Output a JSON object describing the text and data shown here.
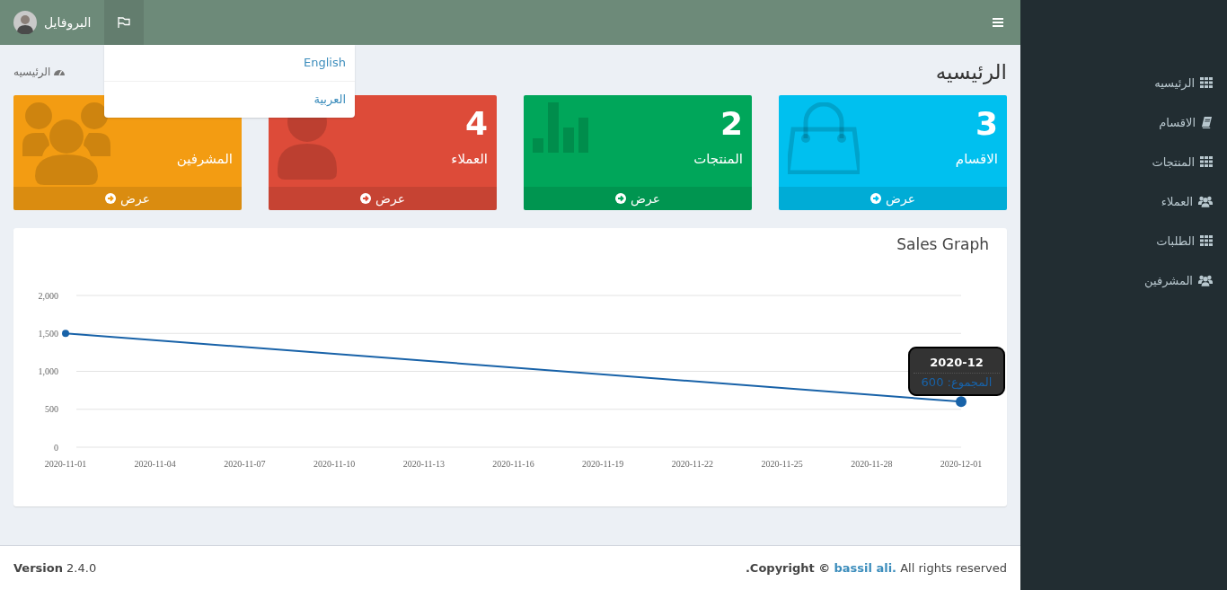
{
  "header": {
    "profile": {
      "label": "البروفايل"
    },
    "language_menu": {
      "expanded": true,
      "items": [
        {
          "label": "English"
        },
        {
          "label": "العربية"
        }
      ]
    }
  },
  "page": {
    "title": "الرئيسيه",
    "breadcrumb": "الرئيسيه"
  },
  "stats": [
    {
      "count": "3",
      "label": "الاقسام",
      "link": "عرض",
      "color": "#00c0ef"
    },
    {
      "count": "2",
      "label": "المنتجات",
      "link": "عرض",
      "color": "#00a65a"
    },
    {
      "count": "4",
      "label": "العملاء",
      "link": "عرض",
      "color": "#dd4b39"
    },
    {
      "label": "المشرفين",
      "link": "عرض",
      "color": "#f39c12"
    }
  ],
  "chart": {
    "title": "Sales Graph",
    "tooltip": {
      "title": "2020-12",
      "label": "المجموع: 600"
    },
    "chart_data": {
      "type": "line",
      "ylim": [
        0,
        2000
      ],
      "grid": true,
      "categories": [
        "2020-11-01",
        "2020-11-04",
        "2020-11-07",
        "2020-11-10",
        "2020-11-13",
        "2020-11-16",
        "2020-11-19",
        "2020-11-22",
        "2020-11-25",
        "2020-11-28",
        "2020-12-01"
      ],
      "series": [
        {
          "color": "#1862a8",
          "values": [
            1500,
            null,
            null,
            null,
            null,
            null,
            null,
            null,
            null,
            null,
            600
          ]
        }
      ],
      "yticks": [
        {
          "value": 0,
          "label": "0"
        },
        {
          "value": 500,
          "label": "500"
        },
        {
          "value": 1000,
          "label": "1,000"
        },
        {
          "value": 1500,
          "label": "1,500"
        },
        {
          "value": 2000,
          "label": "2,000"
        }
      ]
    }
  },
  "sidebar": {
    "items": [
      {
        "label": "الرئيسيه"
      },
      {
        "label": "الاقسام"
      },
      {
        "label": "المنتجات"
      },
      {
        "label": "العملاء"
      },
      {
        "label": "الطلبات"
      },
      {
        "label": "المشرفين"
      }
    ]
  },
  "footer": {
    "version": "**Version** 2.4.0",
    "copyright_prefix": ".Copyright ©",
    "copyright_link": "bassil ali.",
    "copyright_suffix": "All rights reserved"
  }
}
